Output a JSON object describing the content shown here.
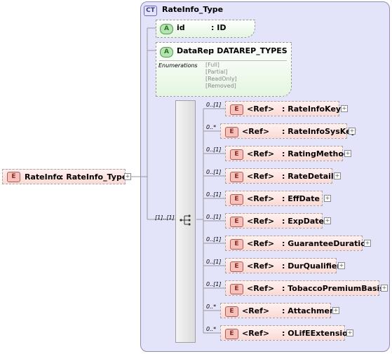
{
  "root_element": {
    "badge": "E",
    "name": "RateInfo",
    "type": ": RateInfo_Type"
  },
  "complex_type": {
    "badge": "CT",
    "name": "RateInfo_Type"
  },
  "attributes": [
    {
      "badge": "A",
      "name": "id",
      "type": ": ID"
    },
    {
      "badge": "A",
      "name": "DataRep",
      "type": ": DATAREP_TYPES"
    }
  ],
  "enumerations": {
    "label": "Enumerations",
    "values": [
      "[Full]",
      "[Partial]",
      "[ReadOnly]",
      "[Removed]"
    ]
  },
  "sequence": {
    "occurrence": "[1]..[1]"
  },
  "children": [
    {
      "badge": "E",
      "ref": "<Ref>",
      "name": ": RateInfoKey",
      "occurrence": "0..[1]"
    },
    {
      "badge": "E",
      "ref": "<Ref>",
      "name": ": RateInfoSysKey",
      "occurrence": "0..*"
    },
    {
      "badge": "E",
      "ref": "<Ref>",
      "name": ": RatingMethod",
      "occurrence": "0..[1]"
    },
    {
      "badge": "E",
      "ref": "<Ref>",
      "name": ": RateDetails",
      "occurrence": "0..[1]"
    },
    {
      "badge": "E",
      "ref": "<Ref>",
      "name": ": EffDate",
      "occurrence": "0..[1]"
    },
    {
      "badge": "E",
      "ref": "<Ref>",
      "name": ": ExpDate",
      "occurrence": "0..[1]"
    },
    {
      "badge": "E",
      "ref": "<Ref>",
      "name": ": GuaranteeDuration",
      "occurrence": "0..[1]"
    },
    {
      "badge": "E",
      "ref": "<Ref>",
      "name": ": DurQualifier",
      "occurrence": "0..[1]"
    },
    {
      "badge": "E",
      "ref": "<Ref>",
      "name": ": TobaccoPremiumBasis",
      "occurrence": "0..[1]"
    },
    {
      "badge": "E",
      "ref": "<Ref>",
      "name": ": Attachment",
      "occurrence": "0..*"
    },
    {
      "badge": "E",
      "ref": "<Ref>",
      "name": ": OLifEExtension",
      "occurrence": "0..*"
    }
  ]
}
